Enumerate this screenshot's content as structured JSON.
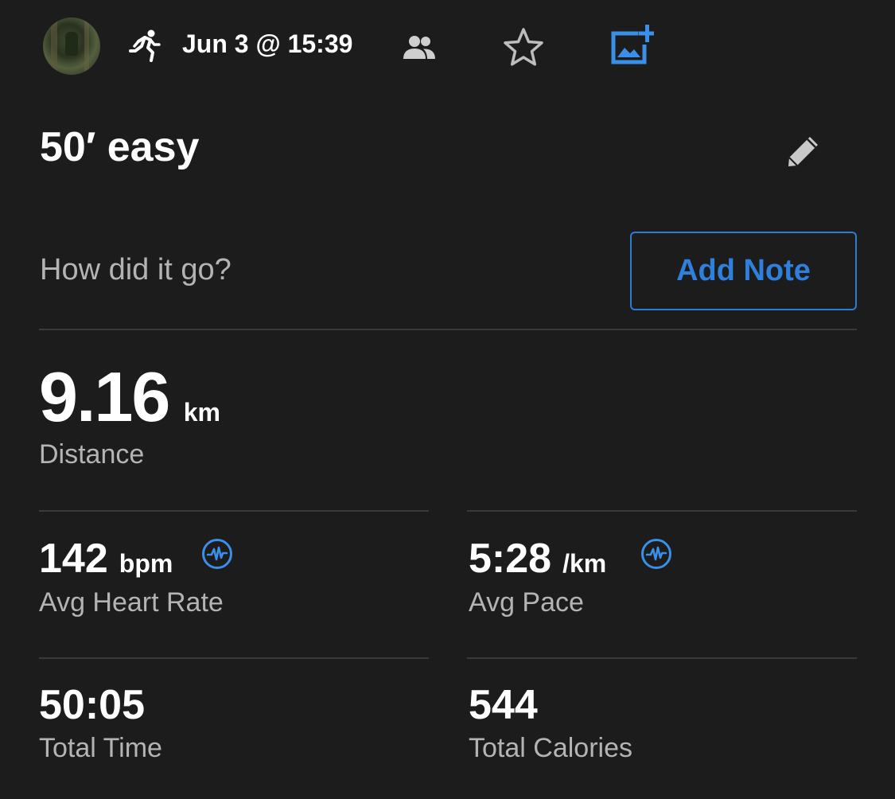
{
  "header": {
    "date": "Jun 3 @ 15:39"
  },
  "activity": {
    "title": "50′ easy"
  },
  "note": {
    "prompt": "How did it go?",
    "button_label": "Add Note"
  },
  "stats": {
    "distance": {
      "value": "9.16",
      "unit": "km",
      "label": "Distance"
    },
    "heart_rate": {
      "value": "142",
      "unit": "bpm",
      "label": "Avg Heart Rate"
    },
    "pace": {
      "value": "5:28",
      "unit": "/km",
      "label": "Avg Pace"
    },
    "time": {
      "value": "50:05",
      "label": "Total Time"
    },
    "calories": {
      "value": "544",
      "label": "Total Calories"
    }
  },
  "icons": {
    "activity_type": "running-icon",
    "privacy": "group-icon",
    "favorite": "star-icon",
    "add_photo": "add-photo-icon",
    "edit": "pencil-icon",
    "chart": "pulse-chart-icon"
  },
  "colors": {
    "background": "#1c1c1c",
    "accent": "#2f7fdc",
    "secondary_text": "#b4b4b4",
    "divider": "#3a3a3a"
  }
}
